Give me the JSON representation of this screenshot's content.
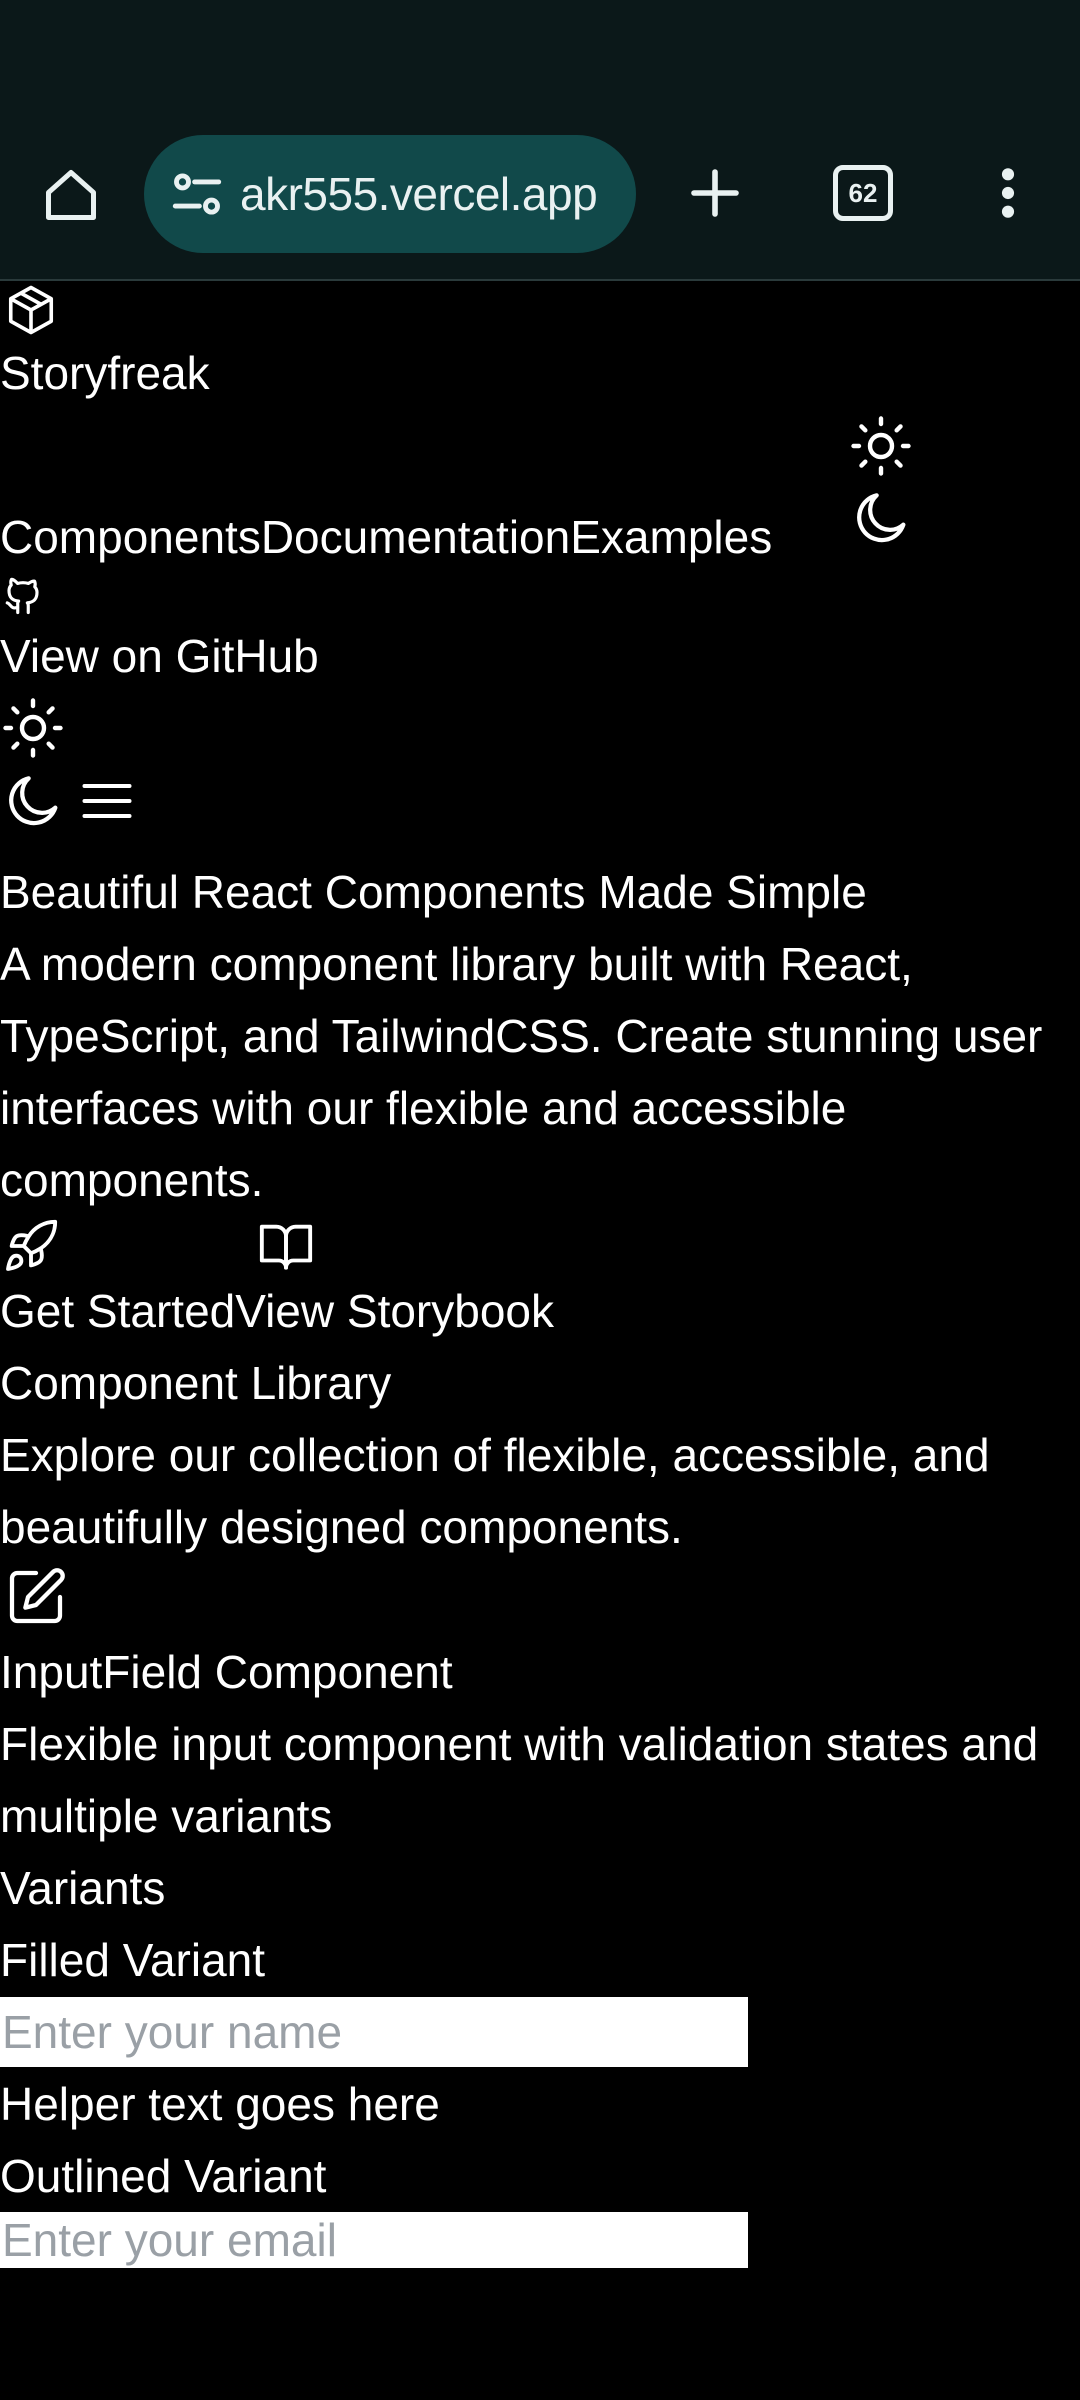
{
  "browser": {
    "url_text": "akr555.vercel.app",
    "tab_count": "62"
  },
  "header": {
    "brand": "Storyfreak",
    "nav": [
      "Components",
      "Documentation",
      "Examples"
    ],
    "github_label": "View on GitHub"
  },
  "hero": {
    "title": "Beautiful React Components Made Simple",
    "description": "A modern component library built with React, TypeScript, and TailwindCSS. Create stunning user interfaces with our flexible and accessible components.",
    "get_started": "Get Started",
    "view_storybook": "View Storybook"
  },
  "library": {
    "title": "Component Library",
    "description": "Explore our collection of flexible, accessible, and beautifully designed components."
  },
  "inputfield": {
    "title": "InputField Component",
    "description": "Flexible input component with validation states and multiple variants",
    "variants_heading": "Variants",
    "filled_label": "Filled Variant",
    "filled_placeholder": "Enter your name",
    "helper_text": "Helper text goes here",
    "outlined_label": "Outlined Variant",
    "outlined_placeholder": "Enter your email"
  }
}
